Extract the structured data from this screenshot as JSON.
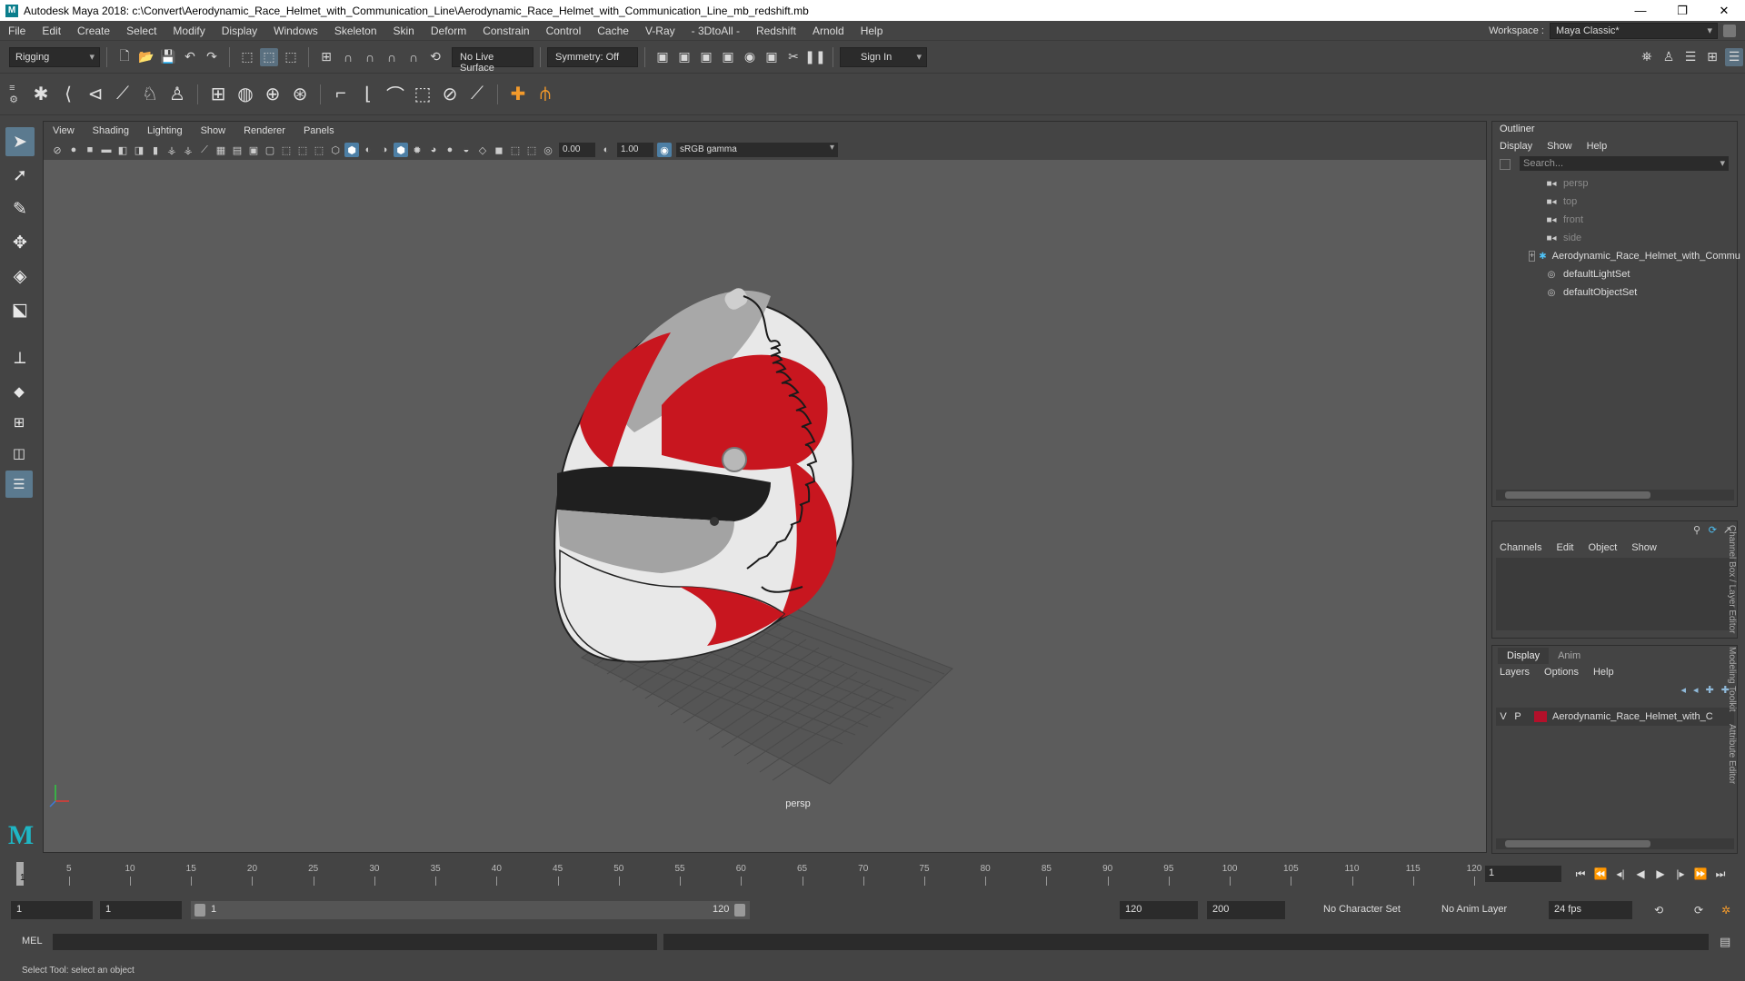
{
  "window": {
    "title": "Autodesk Maya 2018: c:\\Convert\\Aerodynamic_Race_Helmet_with_Communication_Line\\Aerodynamic_Race_Helmet_with_Communication_Line_mb_redshift.mb",
    "logo": "M",
    "minimize": "—",
    "maximize": "❐",
    "close": "✕"
  },
  "menubar": {
    "items": [
      "File",
      "Edit",
      "Create",
      "Select",
      "Modify",
      "Display",
      "Windows",
      "Skeleton",
      "Skin",
      "Deform",
      "Constrain",
      "Control",
      "Cache",
      "V-Ray",
      "- 3DtoAll -",
      "Redshift",
      "Arnold",
      "Help"
    ],
    "workspace_label": "Workspace :",
    "workspace_value": "Maya Classic*"
  },
  "statusline": {
    "menuset": "Rigging",
    "live_surface": "No Live Surface",
    "symmetry": "Symmetry: Off",
    "sign_in": "Sign In"
  },
  "viewport": {
    "menus": [
      "View",
      "Shading",
      "Lighting",
      "Show",
      "Renderer",
      "Panels"
    ],
    "near_clip": "0.00",
    "far_clip": "1.00",
    "color_space": "sRGB gamma",
    "camera": "persp"
  },
  "outliner": {
    "title": "Outliner",
    "menus": [
      "Display",
      "Show",
      "Help"
    ],
    "search_placeholder": "Search...",
    "items": [
      {
        "label": "persp",
        "icon": "camera-icon",
        "dim": true
      },
      {
        "label": "top",
        "icon": "camera-icon",
        "dim": true
      },
      {
        "label": "front",
        "icon": "camera-icon",
        "dim": true
      },
      {
        "label": "side",
        "icon": "camera-icon",
        "dim": true
      },
      {
        "label": "Aerodynamic_Race_Helmet_with_Commu",
        "icon": "transform-icon",
        "dim": false
      },
      {
        "label": "defaultLightSet",
        "icon": "set-icon",
        "dim": false
      },
      {
        "label": "defaultObjectSet",
        "icon": "set-icon",
        "dim": false
      }
    ]
  },
  "channelbox": {
    "menus": [
      "Channels",
      "Edit",
      "Object",
      "Show"
    ]
  },
  "layereditor": {
    "tabs": [
      "Display",
      "Anim"
    ],
    "menus": [
      "Layers",
      "Options",
      "Help"
    ],
    "layer": {
      "v": "V",
      "p": "P",
      "name": "Aerodynamic_Race_Helmet_with_C",
      "color": "#b3102a"
    }
  },
  "right_vtabs": [
    "Channel Box / Layer Editor",
    "Modeling Toolkit",
    "Attribute Editor"
  ],
  "timeslider": {
    "ticks": [
      "5",
      "10",
      "15",
      "20",
      "25",
      "30",
      "35",
      "40",
      "45",
      "50",
      "55",
      "60",
      "65",
      "70",
      "75",
      "80",
      "85",
      "90",
      "95",
      "100",
      "105",
      "110",
      "115",
      "120"
    ],
    "current_frame": "1",
    "frame_field": "1"
  },
  "rangeslider": {
    "start": "1",
    "playback_start": "1",
    "range_start_label": "1",
    "range_end_label": "120",
    "playback_end": "120",
    "end": "200",
    "character_set": "No Character Set",
    "anim_layer": "No Anim Layer",
    "fps": "24 fps"
  },
  "cmdline": {
    "label": "MEL"
  },
  "helpline": {
    "text": "Select Tool: select an object"
  },
  "colors": {
    "helmet_red": "#c8161f",
    "helmet_white": "#eaeaea",
    "helmet_grey": "#a3a3a3",
    "maya_teal": "#1fb6c4"
  }
}
